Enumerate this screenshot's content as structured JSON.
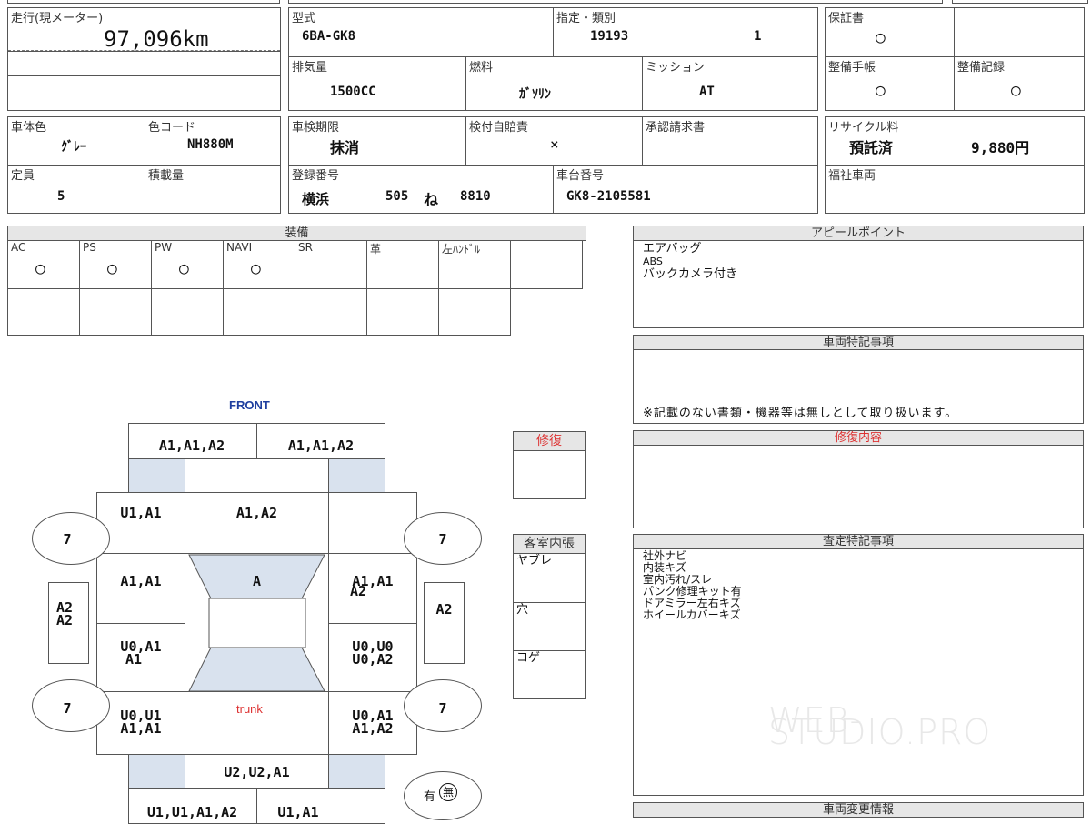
{
  "mileage": {
    "label": "走行(現メーター)",
    "value": "97,096km"
  },
  "model": {
    "label": "型式",
    "value": "6BA-GK8"
  },
  "designation": {
    "label": "指定・類別",
    "value1": "19193",
    "value2": "1"
  },
  "warranty": {
    "label": "保証書",
    "value": "○"
  },
  "displacement": {
    "label": "排気量",
    "value": "1500CC"
  },
  "fuel": {
    "label": "燃料",
    "value": "ｶﾞｿﾘﾝ"
  },
  "mission": {
    "label": "ミッション",
    "value": "AT"
  },
  "maintenance_book": {
    "label": "整備手帳",
    "value": "○"
  },
  "maintenance_record": {
    "label": "整備記録",
    "value": "○"
  },
  "body_color": {
    "label": "車体色",
    "value": "ｸﾞﾚｰ"
  },
  "color_code": {
    "label": "色コード",
    "value": "NH880M"
  },
  "inspection": {
    "label": "車検期限",
    "value": "抹消"
  },
  "insurance": {
    "label": "検付自賠責",
    "value": "×"
  },
  "approval": {
    "label": "承認請求書",
    "value": ""
  },
  "recycle": {
    "label": "リサイクル料",
    "status": "預託済",
    "amount": "9,880円"
  },
  "capacity": {
    "label": "定員",
    "value": "5"
  },
  "load": {
    "label": "積載量",
    "value": ""
  },
  "registration": {
    "label": "登録番号",
    "city": "横浜",
    "class": "505",
    "kana": "ね",
    "number": "8810"
  },
  "chassis": {
    "label": "車台番号",
    "value": "GK8-2105581"
  },
  "welfare": {
    "label": "福祉車両"
  },
  "equipment": {
    "title": "装備",
    "items": [
      {
        "label": "AC",
        "value": "○"
      },
      {
        "label": "PS",
        "value": "○"
      },
      {
        "label": "PW",
        "value": "○"
      },
      {
        "label": "NAVI",
        "value": "○"
      },
      {
        "label": "SR",
        "value": ""
      },
      {
        "label": "革",
        "value": ""
      },
      {
        "label": "左ﾊﾝﾄﾞﾙ",
        "value": ""
      }
    ]
  },
  "appeal": {
    "title": "アピールポイント",
    "lines": [
      "エアバッグ",
      "ABS",
      "バックカメラ付き"
    ]
  },
  "special_notes": {
    "title": "車両特記事項",
    "note": "※記載のない書類・機器等は無しとして取り扱います。"
  },
  "repair": {
    "label": "修復"
  },
  "repair_details": {
    "title": "修復内容"
  },
  "interior": {
    "title": "客室内張",
    "items": [
      "ヤブレ",
      "穴",
      "コゲ"
    ]
  },
  "assessment": {
    "title": "査定特記事項",
    "lines": [
      "社外ナビ",
      "内装キズ",
      "室内汚れ/スレ",
      "パンク修理キット有",
      "ドアミラー左右キズ",
      "ホイールカバーキズ"
    ]
  },
  "changes": {
    "title": "車両変更情報"
  },
  "diagram": {
    "front": "FRONT",
    "trunk": "trunk",
    "front_bumper_left": "A1,A1,A2",
    "front_bumper_right": "A1,A1,A2",
    "fender_left": "U1,A1",
    "hood": "A1,A2",
    "front_door_left": "A1,A1",
    "roof": "A",
    "front_door_right_1": "A1,A1",
    "front_door_right_2": "A2",
    "rear_door_left_1": "U0,A1",
    "rear_door_left_2": "A1",
    "rear_door_right_1": "U0,U0",
    "rear_door_right_2": "U0,A2",
    "quarter_left_1": "U0,U1",
    "quarter_left_2": "A1,A1",
    "quarter_right_1": "U0,A1",
    "quarter_right_2": "A1,A2",
    "trunk_lid": "U2,U2,A1",
    "rear_bumper_left": "U1,U1,A1,A2",
    "rear_bumper_right": "U1,A1",
    "step_left_1": "A2",
    "step_left_2": "A2",
    "step_right": "A2",
    "tire_fl": "7",
    "tire_fr": "7",
    "tire_rl": "7",
    "tire_rr": "7",
    "spare": "有",
    "spare_none": "無"
  },
  "watermark": "WEB-STUDIO.PRO"
}
